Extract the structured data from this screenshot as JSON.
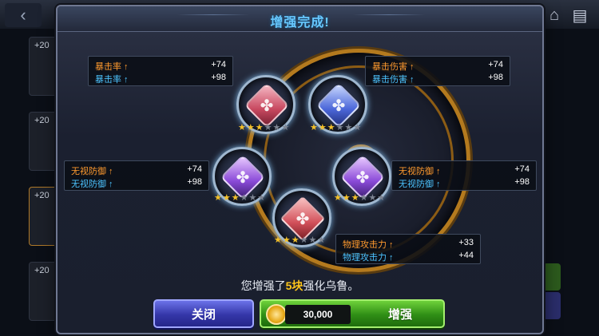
{
  "modal": {
    "title": "增强完成!"
  },
  "background": {
    "side_levels": [
      "+20",
      "+20",
      "+20",
      "+20"
    ]
  },
  "stats": [
    {
      "id": "crit-rate",
      "rows": [
        {
          "label": "暴击率 ↑",
          "value": "+74",
          "color": "orange"
        },
        {
          "label": "暴击率 ↑",
          "value": "+98",
          "color": "blue"
        }
      ]
    },
    {
      "id": "crit-damage",
      "rows": [
        {
          "label": "暴击伤害 ↑",
          "value": "+74",
          "color": "orange"
        },
        {
          "label": "暴击伤害 ↑",
          "value": "+98",
          "color": "blue"
        }
      ]
    },
    {
      "id": "ignore-def-left",
      "rows": [
        {
          "label": "无视防御 ↑",
          "value": "+74",
          "color": "orange"
        },
        {
          "label": "无视防御 ↑",
          "value": "+98",
          "color": "blue"
        }
      ]
    },
    {
      "id": "ignore-def-right",
      "rows": [
        {
          "label": "无视防御 ↑",
          "value": "+74",
          "color": "orange"
        },
        {
          "label": "无视防御 ↑",
          "value": "+98",
          "color": "blue"
        }
      ]
    },
    {
      "id": "physical-attack",
      "rows": [
        {
          "label": "物理攻击力 ↑",
          "value": "+33",
          "color": "orange"
        },
        {
          "label": "物理攻击力 ↑",
          "value": "+44",
          "color": "blue"
        }
      ]
    }
  ],
  "gems": [
    {
      "name": "gem-top-left",
      "color": "red",
      "stars": 3,
      "max_stars": 6
    },
    {
      "name": "gem-top-right",
      "color": "blue",
      "stars": 3,
      "max_stars": 6
    },
    {
      "name": "gem-mid-left",
      "color": "purple",
      "stars": 3,
      "max_stars": 6
    },
    {
      "name": "gem-mid-right",
      "color": "purple",
      "stars": 3,
      "max_stars": 6
    },
    {
      "name": "gem-bottom",
      "color": "red",
      "stars": 3,
      "max_stars": 6
    }
  ],
  "message": {
    "prefix": "您增强了",
    "highlight": "5块",
    "suffix": "强化乌鲁。"
  },
  "buttons": {
    "close": "关闭",
    "enhance": "增强",
    "cost": "30,000"
  },
  "colors": {
    "accent_orange": "#ff9a2e",
    "accent_blue": "#4dc4ff",
    "highlight": "#ffc61a",
    "star_on": "#f3c029"
  }
}
